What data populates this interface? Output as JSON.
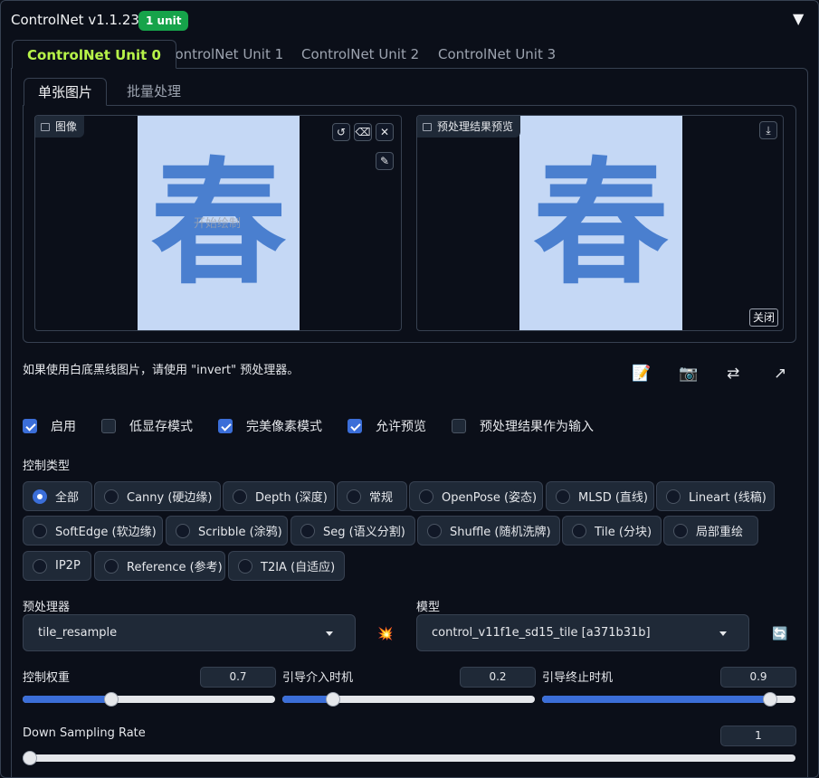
{
  "header": {
    "title": "ControlNet v1.1.233",
    "badge": "1 unit",
    "collapse_icon": "▼"
  },
  "unit_tabs": [
    {
      "label": "ControlNet Unit 0",
      "active": true
    },
    {
      "label": "ControlNet Unit 1",
      "active": false
    },
    {
      "label": "ControlNet Unit 2",
      "active": false
    },
    {
      "label": "ControlNet Unit 3",
      "active": false
    }
  ],
  "image_tabs": [
    {
      "label": "单张图片",
      "active": true
    },
    {
      "label": "批量处理",
      "active": false
    }
  ],
  "input_image": {
    "label": "图像",
    "overlay": "开始绘制",
    "glyph": "春",
    "buttons": [
      "↺",
      "⌫",
      "✕",
      "✎"
    ]
  },
  "preview_image": {
    "label": "预处理结果预览",
    "glyph": "春",
    "download": "⤓",
    "close_label": "关闭"
  },
  "hint": "如果使用白底黑线图片，请使用 \"invert\" 预处理器。",
  "tools": [
    "📝",
    "📷",
    "⇄",
    "↗"
  ],
  "checkboxes": [
    {
      "label": "启用",
      "checked": true
    },
    {
      "label": "低显存模式",
      "checked": false
    },
    {
      "label": "完美像素模式",
      "checked": true
    },
    {
      "label": "允许预览",
      "checked": true
    },
    {
      "label": "预处理结果作为输入",
      "checked": false
    }
  ],
  "control_type": {
    "label": "控制类型",
    "options": [
      {
        "label": "全部",
        "selected": true
      },
      {
        "label": "Canny (硬边缘)",
        "selected": false
      },
      {
        "label": "Depth (深度)",
        "selected": false
      },
      {
        "label": "常规",
        "selected": false
      },
      {
        "label": "OpenPose (姿态)",
        "selected": false
      },
      {
        "label": "MLSD (直线)",
        "selected": false
      },
      {
        "label": "Lineart (线稿)",
        "selected": false
      },
      {
        "label": "SoftEdge (软边缘)",
        "selected": false
      },
      {
        "label": "Scribble (涂鸦)",
        "selected": false
      },
      {
        "label": "Seg (语义分割)",
        "selected": false
      },
      {
        "label": "Shuffle (随机洗牌)",
        "selected": false
      },
      {
        "label": "Tile (分块)",
        "selected": false
      },
      {
        "label": "局部重绘",
        "selected": false
      },
      {
        "label": "IP2P",
        "selected": false
      },
      {
        "label": "Reference (参考)",
        "selected": false
      },
      {
        "label": "T2IA (自适应)",
        "selected": false
      }
    ]
  },
  "preprocessor": {
    "label": "预处理器",
    "value": "tile_resample",
    "run_icon": "💥"
  },
  "model": {
    "label": "模型",
    "value": "control_v11f1e_sd15_tile [a371b31b]",
    "refresh_icon": "🔄"
  },
  "sliders": [
    {
      "label": "控制权重",
      "value": "0.7",
      "fraction": 0.35
    },
    {
      "label": "引导介入时机",
      "value": "0.2",
      "fraction": 0.2
    },
    {
      "label": "引导终止时机",
      "value": "0.9",
      "fraction": 0.9
    }
  ],
  "down_sampling": {
    "label": "Down Sampling Rate",
    "value": "1",
    "fraction": 0.0
  },
  "colors": {
    "accent": "#3b6ed8",
    "active_tab": "#b7f349",
    "badge": "#16a34a",
    "canvas": "#c5d8f5",
    "glyph": "#4a7fcf"
  }
}
